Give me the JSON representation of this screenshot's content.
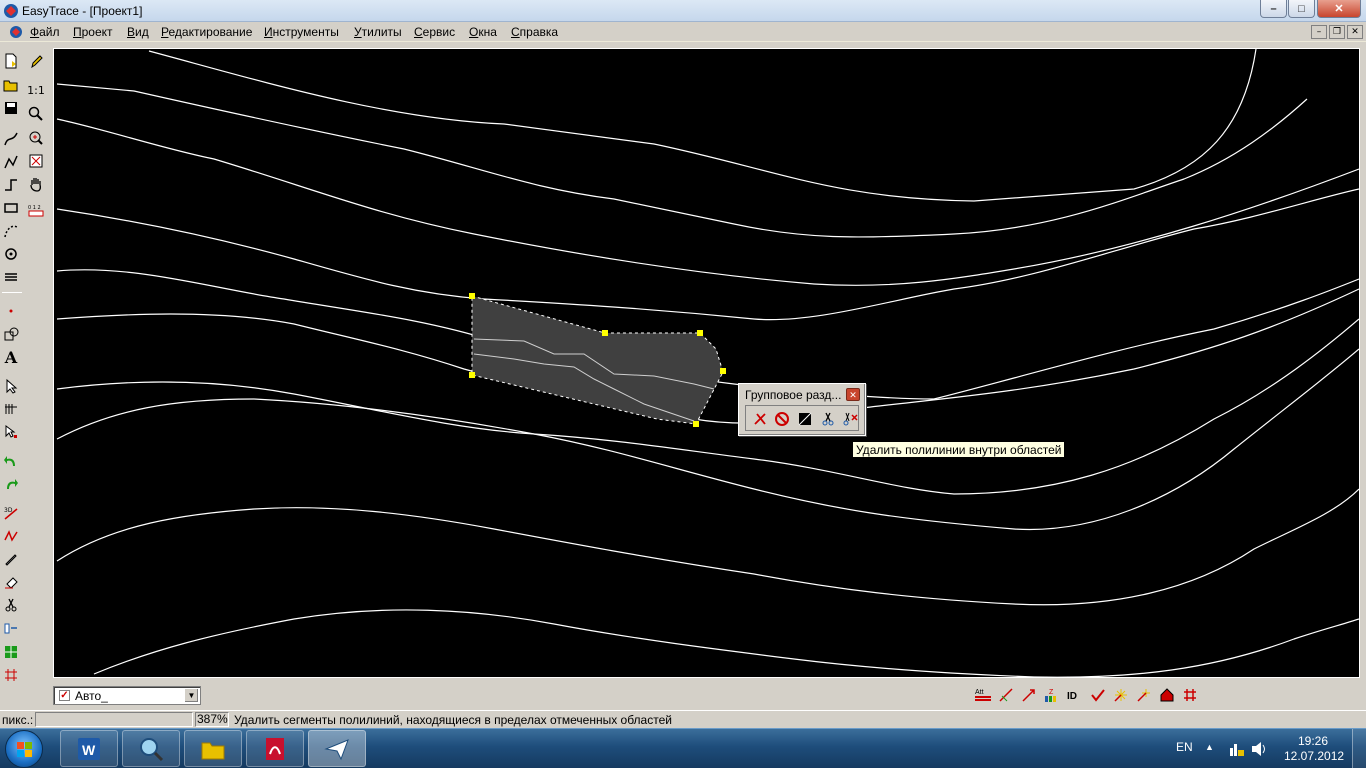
{
  "window": {
    "title": "EasyTrace - [Проект1]",
    "controls": {
      "minimize": "–",
      "maximize": "□",
      "close": "✕"
    }
  },
  "menubar": {
    "items": [
      {
        "label": "Файл"
      },
      {
        "label": "Проект"
      },
      {
        "label": "Вид"
      },
      {
        "label": "Редактирование"
      },
      {
        "label": "Инструменты"
      },
      {
        "label": "Утилиты"
      },
      {
        "label": "Сервис"
      },
      {
        "label": "Окна"
      },
      {
        "label": "Справка"
      }
    ],
    "mdi_controls": {
      "minimize": "–",
      "restore": "❐",
      "close": "✕"
    }
  },
  "left_toolbar": {
    "zoom_one_label": "1:1",
    "ruler_label": "0 1 2"
  },
  "group_panel": {
    "title": "Групповое разд...",
    "close": "✕",
    "tools": [
      {
        "icon": "delete-polyline-icon"
      },
      {
        "icon": "forbid-icon"
      },
      {
        "icon": "area-fill-icon"
      },
      {
        "icon": "scissors-icon"
      },
      {
        "icon": "scissors-delete-icon"
      }
    ]
  },
  "tooltip": {
    "text": "Удалить полилинии внутри областей"
  },
  "layer_select": {
    "value": "Авто_",
    "checked_mark": "✓"
  },
  "statusbar": {
    "coord_label": "пикс.:",
    "coord_value": "",
    "zoom": "387%",
    "message": "Удалить сегменты полилиний, находящиеся в пределах отмеченных областей"
  },
  "taskbar": {
    "apps": [
      {
        "name": "Microsoft Word",
        "icon": "word-icon"
      },
      {
        "name": "Search",
        "icon": "magnifier-icon"
      },
      {
        "name": "Explorer",
        "icon": "folder-icon"
      },
      {
        "name": "Adobe Reader",
        "icon": "pdf-icon"
      },
      {
        "name": "EasyTrace",
        "icon": "easytrace-icon"
      }
    ],
    "language": "EN",
    "time": "19:26",
    "date": "12.07.2012"
  },
  "colors": {
    "canvas_bg": "#000000",
    "contour_line": "#ffffff",
    "selection_fill": "#404040",
    "selection_handle": "#ffff00",
    "tooltip_bg": "#ffffe1"
  }
}
